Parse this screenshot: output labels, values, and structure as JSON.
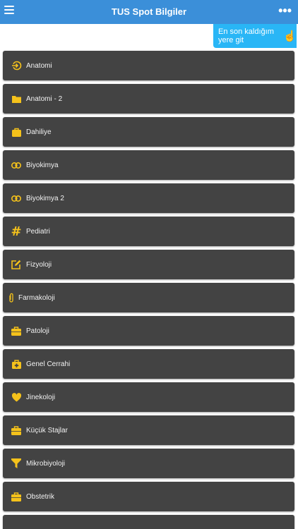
{
  "appbar": {
    "title": "TUS Spot Bilgiler"
  },
  "resume": {
    "label": "En son kaldığım yere git",
    "icon": "hand-pointer-icon"
  },
  "colors": {
    "appbar": "#3b8fd9",
    "resume": "#29b6f6",
    "item_bg": "#434343",
    "icon": "#f5c21b"
  },
  "items": [
    {
      "label": "Anatomi",
      "icon": "login-arrow-icon"
    },
    {
      "label": "Anatomi - 2",
      "icon": "folder-icon"
    },
    {
      "label": "Dahiliye",
      "icon": "bag-icon"
    },
    {
      "label": "Biyokimya",
      "icon": "link-icon"
    },
    {
      "label": "Biyokimya 2",
      "icon": "link-icon"
    },
    {
      "label": "Pediatri",
      "icon": "hash-icon"
    },
    {
      "label": "Fizyoloji",
      "icon": "edit-icon"
    },
    {
      "label": "Farmakoloji",
      "icon": "paperclip-icon"
    },
    {
      "label": "Patoloji",
      "icon": "briefcase-icon"
    },
    {
      "label": "Genel Cerrahi",
      "icon": "medkit-icon"
    },
    {
      "label": "Jinekoloji",
      "icon": "heart-icon"
    },
    {
      "label": "Küçük Stajlar",
      "icon": "briefcase-icon"
    },
    {
      "label": "Mikrobiyoloji",
      "icon": "funnel-icon"
    },
    {
      "label": "Obstetrik",
      "icon": "briefcase-icon"
    }
  ]
}
